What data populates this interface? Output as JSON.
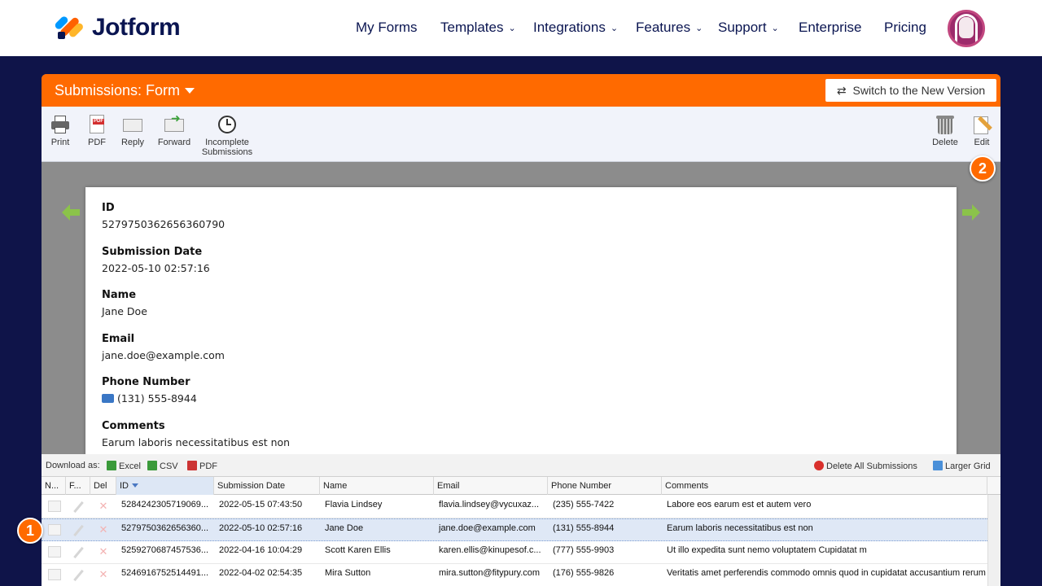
{
  "brand": {
    "name": "Jotform"
  },
  "nav": {
    "items": [
      {
        "label": "My Forms",
        "chevron": false
      },
      {
        "label": "Templates",
        "chevron": true
      },
      {
        "label": "Integrations",
        "chevron": true
      },
      {
        "label": "Features",
        "chevron": true
      },
      {
        "label": "Support",
        "chevron": true
      },
      {
        "label": "Enterprise",
        "chevron": false
      },
      {
        "label": "Pricing",
        "chevron": false
      }
    ],
    "chevron_glyph": "⌄"
  },
  "panel": {
    "title": "Submissions: Form",
    "switch_label": "Switch to the New Version",
    "switch_icon": "⇄"
  },
  "toolbar": {
    "print": "Print",
    "pdf": "PDF",
    "pdf_icon_text": "PDF",
    "reply": "Reply",
    "forward": "Forward",
    "incomplete_line1": "Incomplete",
    "incomplete_line2": "Submissions",
    "delete": "Delete",
    "edit": "Edit"
  },
  "badges": {
    "first": "1",
    "second": "2"
  },
  "submission": {
    "fields": [
      {
        "label": "ID",
        "value": "5279750362656360790"
      },
      {
        "label": "Submission Date",
        "value": "2022-05-10 02:57:16"
      },
      {
        "label": "Name",
        "value": "Jane Doe"
      },
      {
        "label": "Email",
        "value": "jane.doe@example.com"
      },
      {
        "label": "Phone Number",
        "value": "(131) 555-8944"
      },
      {
        "label": "Comments",
        "value": "Earum laboris necessitatibus est non"
      }
    ]
  },
  "grid": {
    "download_as": "Download as:",
    "excel": "Excel",
    "csv": "CSV",
    "pdf": "PDF",
    "delete_all": "Delete All Submissions",
    "larger_grid": "Larger Grid",
    "headers": [
      "N...",
      "F...",
      "Del",
      "ID",
      "Submission Date",
      "Name",
      "Email",
      "Phone Number",
      "Comments"
    ],
    "rows": [
      {
        "id": "5284242305719069...",
        "date": "2022-05-15 07:43:50",
        "name": "Flavia  Lindsey",
        "email": "flavia.lindsey@vycuxaz...",
        "phone": "(235) 555-7422",
        "comments": "Labore eos earum est et autem vero"
      },
      {
        "id": "5279750362656360...",
        "date": "2022-05-10 02:57:16",
        "name": "Jane Doe",
        "email": "jane.doe@example.com",
        "phone": "(131) 555-8944",
        "comments": "Earum laboris necessitatibus est non"
      },
      {
        "id": "5259270687457536...",
        "date": "2022-04-16 10:04:29",
        "name": "Scott Karen Ellis",
        "email": "karen.ellis@kinupesof.c...",
        "phone": "(777) 555-9903",
        "comments": "Ut illo expedita sunt nemo voluptatem Cupidatat m"
      },
      {
        "id": "5246916752514491...",
        "date": "2022-04-02 02:54:35",
        "name": "Mira Sutton",
        "email": "mira.sutton@fitypury.com",
        "phone": "(176) 555-9826",
        "comments": "Veritatis amet perferendis commodo omnis quod in cupidatat accusantium rerum"
      }
    ],
    "selected_row": 1
  }
}
